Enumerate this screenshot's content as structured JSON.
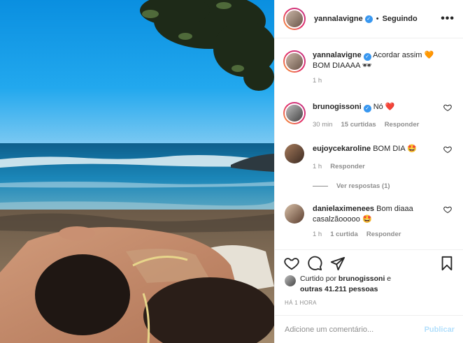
{
  "post": {
    "author": "yannalavigne",
    "follow_separator": "•",
    "follow_status": "Seguindo",
    "more_glyph": "•••",
    "verified_glyph": "✓",
    "photo_alt": "Casal deitado na areia de uma praia sob uma árvore"
  },
  "comments": [
    {
      "user": "yannalavigne",
      "text": "Acordar assim",
      "emoji": "🧡",
      "text2": "BOM DIAAAA",
      "emoji2": "🕶",
      "time": "1 h",
      "verified": true,
      "is_caption": true
    },
    {
      "user": "brunogissoni",
      "text": "Nó",
      "emoji": "❤️",
      "time": "30 min",
      "likes": "15 curtidas",
      "reply": "Responder",
      "verified": true
    },
    {
      "user": "eujoycekaroline",
      "text": "BOM DIA",
      "emoji": "🤩",
      "time": "1 h",
      "reply": "Responder"
    },
    {
      "user": "danielaximenees",
      "text": "Bom diaaa casalzãooooo",
      "emoji": "🤩",
      "time": "1 h",
      "likes": "1 curtida",
      "reply": "Responder"
    }
  ],
  "view_replies": "Ver respostas (1)",
  "likes": {
    "prefix": "Curtido por",
    "user": "brunogissoni",
    "connector": "e",
    "others": "outras 41.211 pessoas"
  },
  "posted_time": "HÁ 1 HORA",
  "add_comment": {
    "placeholder": "Adicione um comentário...",
    "publish": "Publicar"
  },
  "icons": [
    "heart-icon",
    "comment-icon",
    "share-icon",
    "bookmark-icon"
  ],
  "colors": {
    "accent": "#3897f0",
    "like": "#ed4956",
    "muted": "#8e8e8e",
    "publish_disabled": "#b2dffc"
  }
}
